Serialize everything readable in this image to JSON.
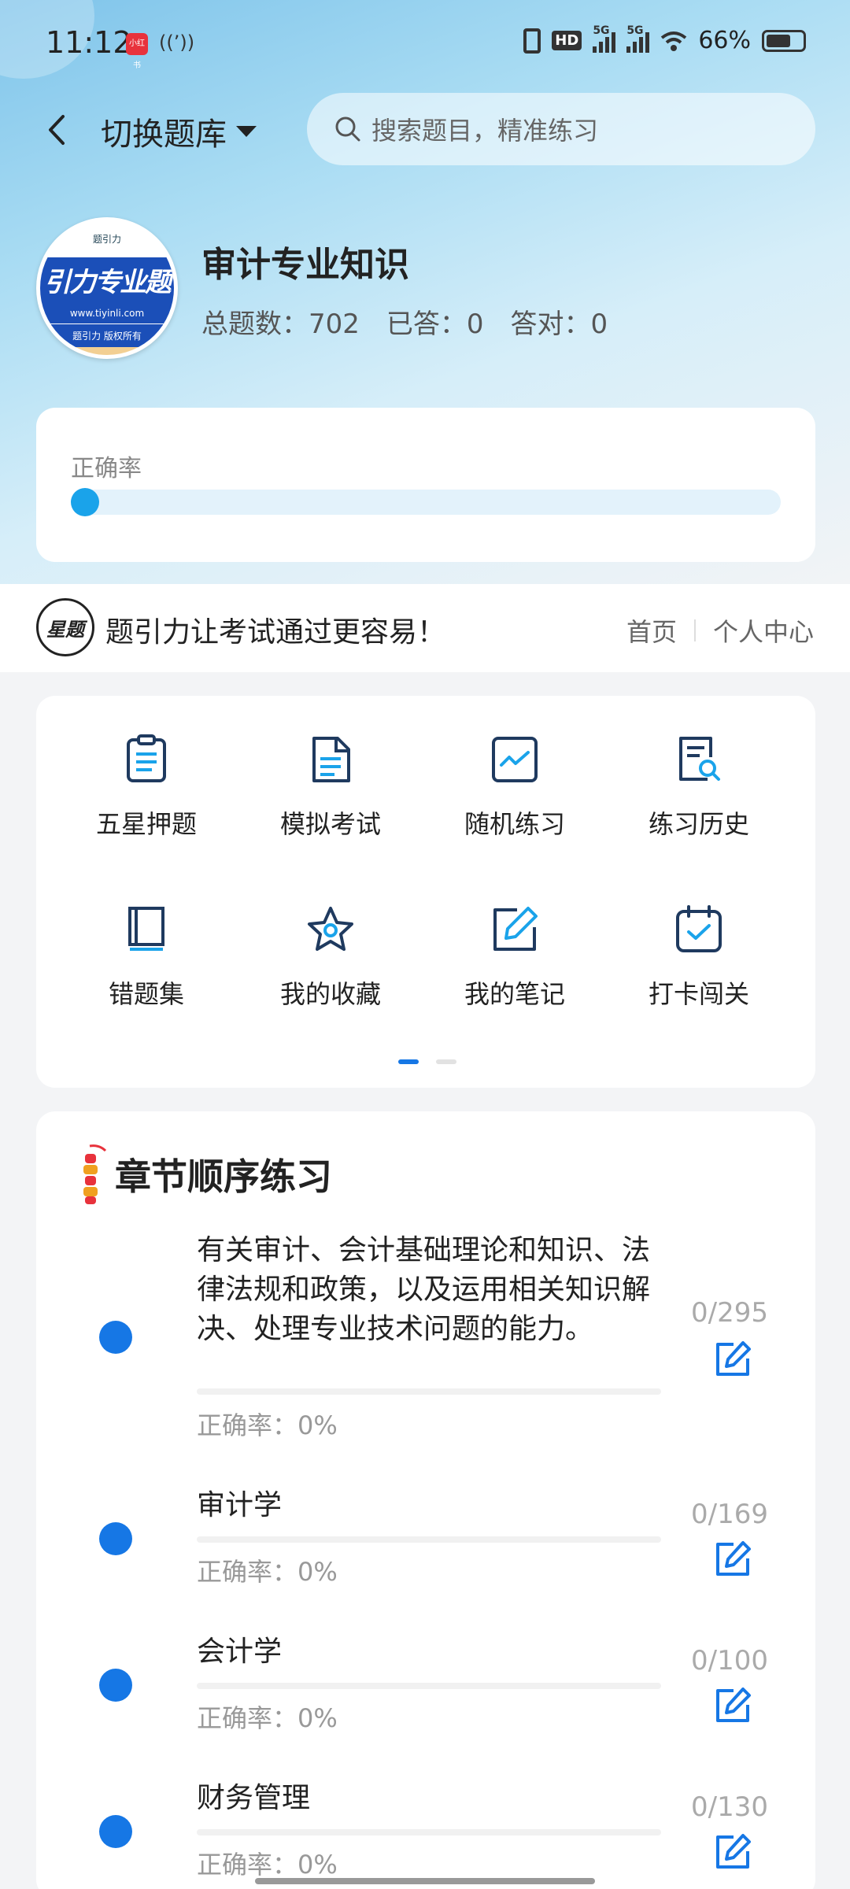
{
  "status_bar": {
    "time": "11:12",
    "app_badge": "小红书",
    "battery": "66%",
    "network_1": "5G",
    "network_2": "5G",
    "hd": "HD"
  },
  "header": {
    "switch_label": "切换题库",
    "search_placeholder": "搜索题目，精准练习"
  },
  "bank": {
    "logo_top": "题引力",
    "logo_text": "引力专业题",
    "logo_url": "www.tiyinli.com",
    "logo_bottom": "题引力 版权所有",
    "title": "审计专业知识",
    "total": "总题数：702",
    "answered": "已答：0",
    "correct": "答对：0"
  },
  "accuracy": {
    "label": "正确率",
    "value": 0
  },
  "slogan": {
    "logo_text": "星题引力",
    "text": "题引力让考试通过更容易！",
    "link_home": "首页",
    "link_profile": "个人中心"
  },
  "features": [
    {
      "label": "五星押题",
      "icon": "clipboard-icon"
    },
    {
      "label": "模拟考试",
      "icon": "document-icon"
    },
    {
      "label": "随机练习",
      "icon": "chart-line-icon"
    },
    {
      "label": "练习历史",
      "icon": "search-document-icon"
    },
    {
      "label": "错题集",
      "icon": "book-icon"
    },
    {
      "label": "我的收藏",
      "icon": "star-icon"
    },
    {
      "label": "我的笔记",
      "icon": "edit-icon"
    },
    {
      "label": "打卡闯关",
      "icon": "calendar-check-icon"
    }
  ],
  "chapters": {
    "title": "章节顺序练习",
    "items": [
      {
        "name": "有关审计、会计基础理论和知识、法律法规和政策，以及运用相关知识解决、处理专业技术问题的能力。",
        "accuracy": "正确率：0%",
        "count": "0/295"
      },
      {
        "name": "审计学",
        "accuracy": "正确率：0%",
        "count": "0/169"
      },
      {
        "name": "会计学",
        "accuracy": "正确率：0%",
        "count": "0/100"
      },
      {
        "name": "财务管理",
        "accuracy": "正确率：0%",
        "count": "0/130"
      }
    ]
  },
  "colors": {
    "accent": "#1677e5",
    "accuracy_dot": "#1aa3ea",
    "icon_stroke": "#1f3a5f",
    "icon_accent": "#1aa3ea"
  }
}
